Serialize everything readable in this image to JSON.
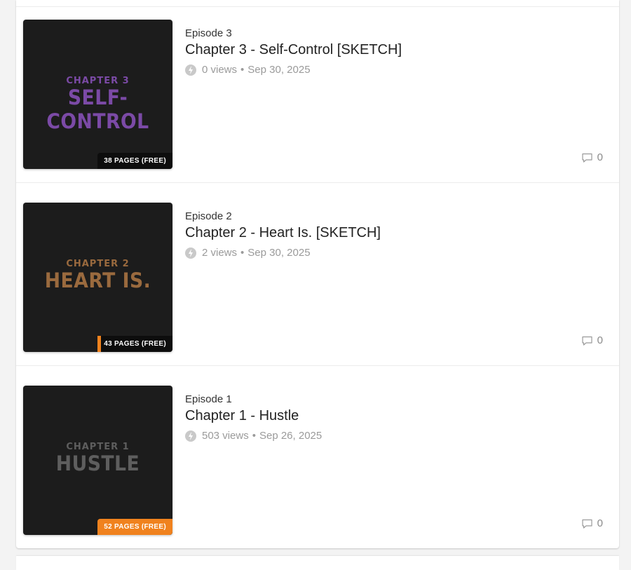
{
  "colors": {
    "accent": "#f0821e",
    "thumb_bg": "#1c1c1c",
    "meta_text": "#9a9a9a"
  },
  "episodes": [
    {
      "number_label": "Episode 3",
      "title": "Chapter 3 - Self-Control [SKETCH]",
      "views": "0 views",
      "date": "Sep 30, 2025",
      "comments": "0",
      "thumb": {
        "chapter": "CHAPTER 3",
        "title": "SELF-CONTROL",
        "color": "#7b4aa6"
      },
      "pages_badge": "38 PAGES (FREE)",
      "read_progress": 0
    },
    {
      "number_label": "Episode 2",
      "title": "Chapter 2 - Heart Is. [SKETCH]",
      "views": "2 views",
      "date": "Sep 30, 2025",
      "comments": "0",
      "thumb": {
        "chapter": "CHAPTER 2",
        "title": "HEART IS.",
        "color": "#9a6a3e"
      },
      "pages_badge": "43 PAGES (FREE)",
      "read_progress": 0.05
    },
    {
      "number_label": "Episode 1",
      "title": "Chapter 1 - Hustle",
      "views": "503 views",
      "date": "Sep 26, 2025",
      "comments": "0",
      "thumb": {
        "chapter": "CHAPTER 1",
        "title": "HUSTLE",
        "color": "#5e5e5e"
      },
      "pages_badge": "52 PAGES (FREE)",
      "read_progress": 1
    }
  ],
  "meta_separator": "•",
  "icons": {
    "views": "bolt-icon",
    "comments": "comment-bubble-icon"
  }
}
